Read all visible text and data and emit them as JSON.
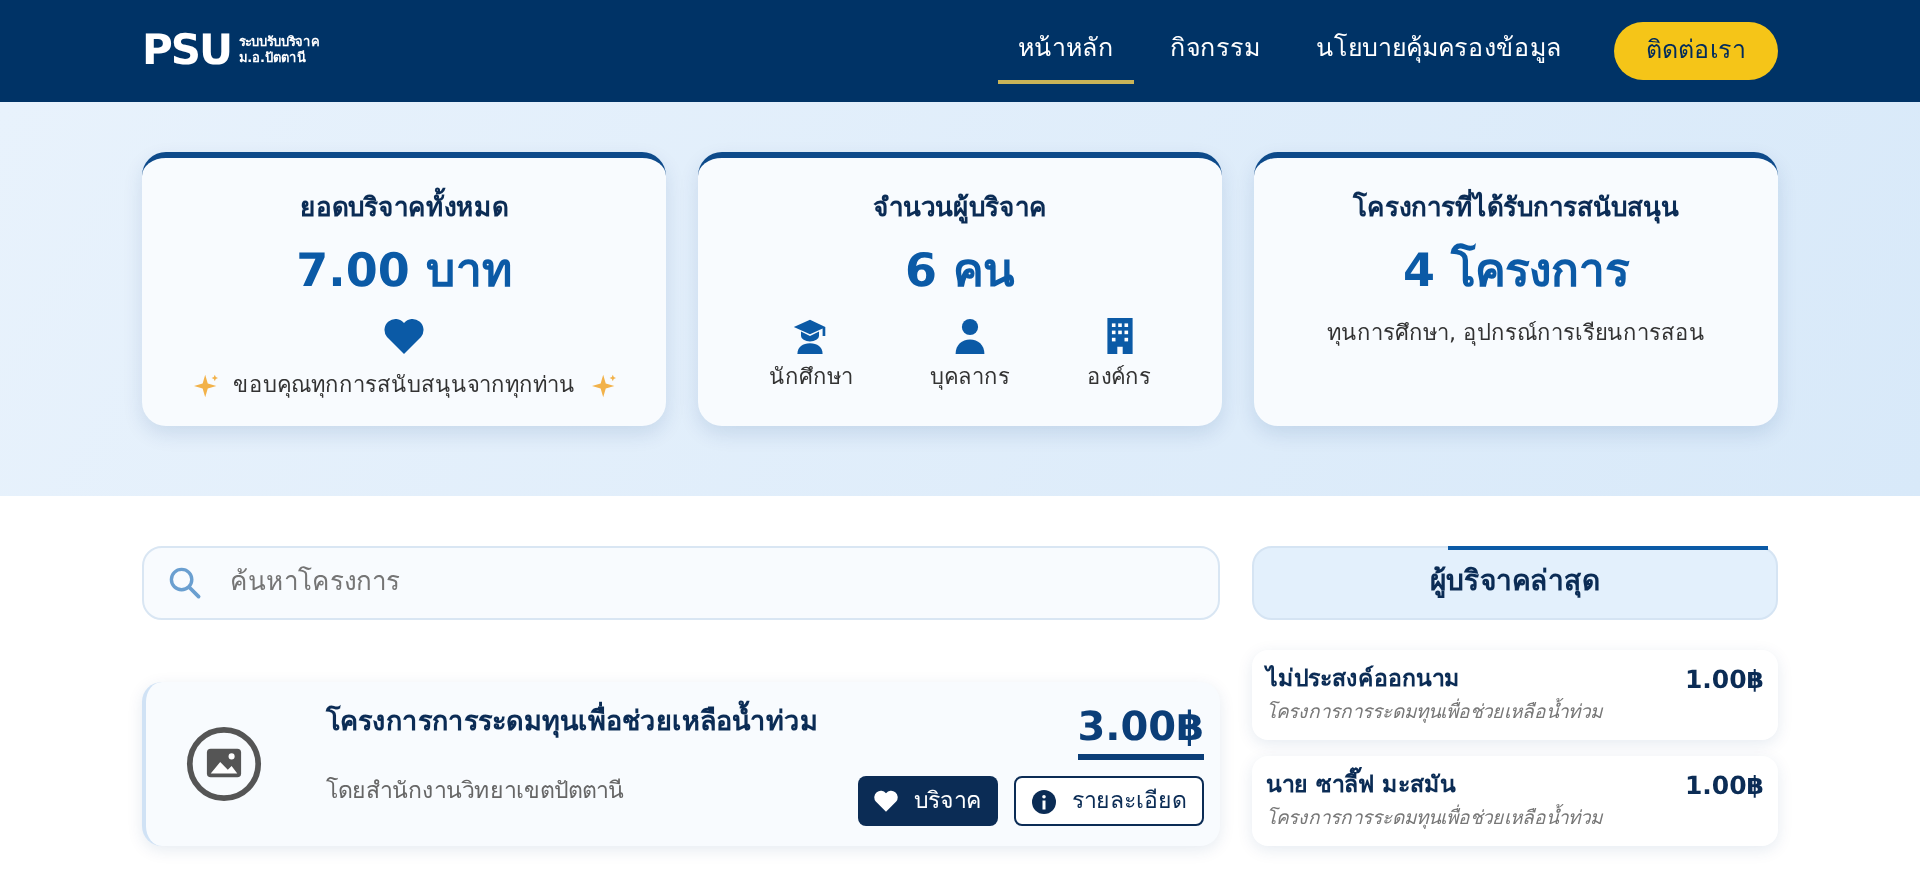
{
  "navbar": {
    "logo": {
      "mark": "PSU",
      "line_1": "ระบบรับบริจาค",
      "line_2": "ม.อ.ปัตตานี"
    },
    "links": [
      {
        "label": "หน้าหลัก",
        "selected": true
      },
      {
        "label": "กิจกรรม",
        "selected": false
      },
      {
        "label": "นโยบายคุ้มครองข้อมูล",
        "selected": false
      }
    ],
    "contact_button": "ติดต่อเรา"
  },
  "stats": [
    {
      "kind": "note",
      "title": "ยอดบริจาคทั้งหมด",
      "value": "7.00 บาท",
      "note": "ขอบคุณทุกการสนับสนุนจากทุกท่าน"
    },
    {
      "kind": "groups",
      "title": "จำนวนผู้บริจาค",
      "value": "6 คน",
      "groups": [
        {
          "kind": "student",
          "label": "นักศึกษา"
        },
        {
          "kind": "staff",
          "label": "บุคลากร"
        },
        {
          "kind": "building",
          "label": "องค์กร"
        }
      ]
    },
    {
      "kind": "subtitle",
      "title": "โครงการที่ได้รับการสนับสนุน",
      "value": "4 โครงการ",
      "subtitle": "ทุนการศึกษา, อุปกรณ์การเรียนการสอน"
    }
  ],
  "search": {
    "placeholder": "ค้นหาโครงการ"
  },
  "projects": [
    {
      "title": "โครงการการระดมทุนเพื่อช่วยเหลือน้ำท่วม",
      "organizer": "โดยสำนักงานวิทยาเขตปัตตานี",
      "amount": "3.00฿",
      "donate_button": "บริจาค",
      "details_button": "รายละเอียด"
    }
  ],
  "recent_donors": {
    "title": "ผู้บริจาคล่าสุด",
    "items": [
      {
        "name": "ไม่ประสงค์ออกนาม",
        "amount": "1.00฿",
        "project": "โครงการการระดมทุนเพื่อช่วยเหลือน้ำท่วม"
      },
      {
        "name": "นาย ซาลี๊ฟ มะสมัน",
        "amount": "1.00฿",
        "project": "โครงการการระดมทุนเพื่อช่วยเหลือน้ำท่วม"
      }
    ]
  }
}
